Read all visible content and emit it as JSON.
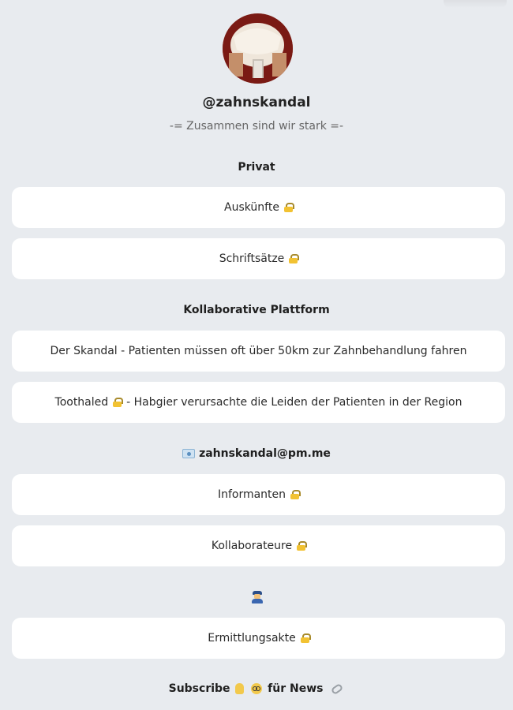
{
  "profile": {
    "handle": "@zahnskandal",
    "bio": "-= Zusammen sind wir stark =-"
  },
  "sections": {
    "privat": "Privat",
    "kollaborative": "Kollaborative Plattform",
    "email": "zahnskandal@pm.me",
    "subscribe_prefix": "Subscribe",
    "subscribe_suffix": "für News"
  },
  "links": {
    "auskuenfte": "Auskünfte",
    "schriftsaetze": "Schriftsätze",
    "skandal": "Der Skandal - Patienten müssen oft über 50km zur Zahnbehandlung fahren",
    "toothaled_prefix": "Toothaled",
    "toothaled_suffix": "- Habgier verursachte die Leiden der Patienten in der Region",
    "informanten": "Informanten",
    "kollaborateure": "Kollaborateure",
    "ermittlungsakte": "Ermittlungsakte"
  },
  "icons": {
    "lock": "lock-icon",
    "mail": "mail-icon",
    "officer": "police-officer-icon",
    "pointing_up": "pointing-up-icon",
    "nerd": "nerd-face-icon",
    "paperclip": "paperclip-icon"
  }
}
